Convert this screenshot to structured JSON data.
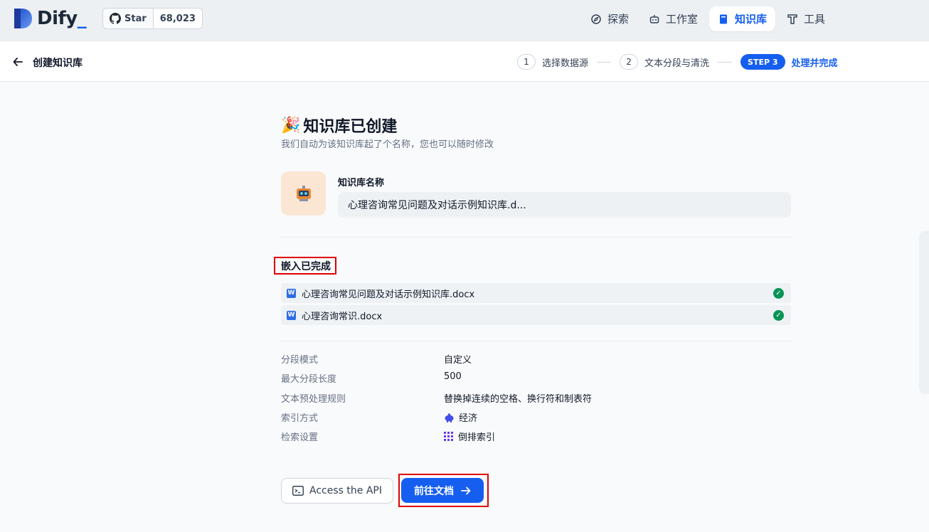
{
  "app": {
    "logo_text": "Dify",
    "logo_suffix": "_",
    "github": {
      "star_label": "Star",
      "star_count": "68,023"
    }
  },
  "nav": {
    "items": [
      {
        "label": "探索",
        "icon": "compass-icon",
        "active": false
      },
      {
        "label": "工作室",
        "icon": "robot-icon",
        "active": false
      },
      {
        "label": "知识库",
        "icon": "book-icon",
        "active": true
      },
      {
        "label": "工具",
        "icon": "hammer-icon",
        "active": false
      }
    ]
  },
  "subheader": {
    "back_label": "创建知识库",
    "steps": [
      {
        "num": "1",
        "label": "选择数据源"
      },
      {
        "num": "2",
        "label": "文本分段与清洗"
      },
      {
        "badge": "STEP 3",
        "label": "处理并完成"
      }
    ]
  },
  "main": {
    "emoji": "🎉",
    "title": "知识库已创建",
    "subtitle": "我们自动为该知识库起了个名称，您也可以随时修改",
    "kb_name_label": "知识库名称",
    "kb_name_value": "心理咨询常见问题及对话示例知识库.d...",
    "embed_title": "嵌入已完成",
    "files": [
      {
        "name": "心理咨询常见问题及对话示例知识库.docx",
        "status": "done"
      },
      {
        "name": "心理咨询常识.docx",
        "status": "done"
      }
    ],
    "settings": [
      {
        "key": "分段模式",
        "value": "自定义"
      },
      {
        "key": "最大分段长度",
        "value": "500"
      },
      {
        "key": "文本预处理规则",
        "value": "替换掉连续的空格、换行符和制表符"
      },
      {
        "key": "索引方式",
        "value": "经济",
        "icon": "piggy-bank-icon"
      },
      {
        "key": "检索设置",
        "value": "倒排索引",
        "icon": "grid-icon"
      }
    ],
    "api_button": "Access the API",
    "docs_button": "前往文档"
  },
  "colors": {
    "accent": "#155eef",
    "highlight_box": "#e00000",
    "success": "#079455"
  }
}
